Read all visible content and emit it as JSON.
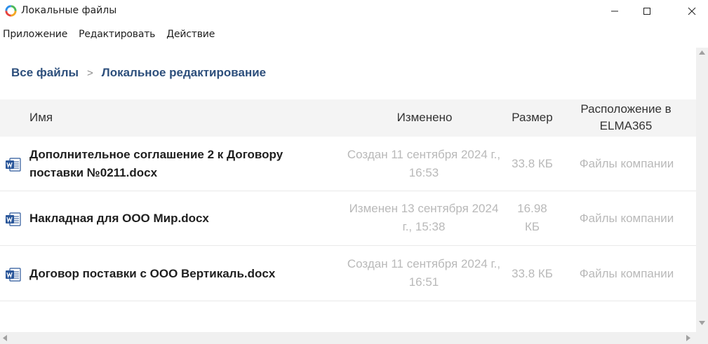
{
  "window": {
    "title": "Локальные файлы",
    "logo_icon": "app-logo-icon",
    "controls": [
      "minimize-icon",
      "maximize-icon",
      "close-icon"
    ]
  },
  "menu": {
    "items": [
      "Приложение",
      "Редактировать",
      "Действие"
    ]
  },
  "breadcrumb": {
    "root": "Все файлы",
    "separator": ">",
    "current": "Локальное редактирование"
  },
  "table": {
    "headers": {
      "name": "Имя",
      "modified": "Изменено",
      "size": "Размер",
      "location_line1": "Расположение в",
      "location_line2": "ELMA365"
    },
    "rows": [
      {
        "icon": "word-document-icon",
        "name_line1": "Дополнительное соглашение 2 к Договору",
        "name_line2": "поставки №0211.docx",
        "modified_line1": "Создан 11 сентября 2024 г.,",
        "modified_line2": "16:53",
        "size_line1": "33.8 КБ",
        "size_line2": "",
        "location": "Файлы компании"
      },
      {
        "icon": "word-document-icon",
        "name_line1": "Накладная для ООО Мир.docx",
        "name_line2": "",
        "modified_line1": "Изменен 13 сентября 2024",
        "modified_line2": "г., 15:38",
        "size_line1": "16.98",
        "size_line2": "КБ",
        "location": "Файлы компании"
      },
      {
        "icon": "word-document-icon",
        "name_line1": "Договор поставки с ООО Вертикаль.docx",
        "name_line2": "",
        "modified_line1": "Создан 11 сентября 2024 г.,",
        "modified_line2": "16:51",
        "size_line1": "33.8 КБ",
        "size_line2": "",
        "location": "Файлы компании"
      }
    ]
  },
  "colors": {
    "breadcrumb": "#2d4f7c",
    "header_bg": "#f4f4f4",
    "muted_text": "#b9b9b9",
    "word_blue": "#2b579a"
  }
}
